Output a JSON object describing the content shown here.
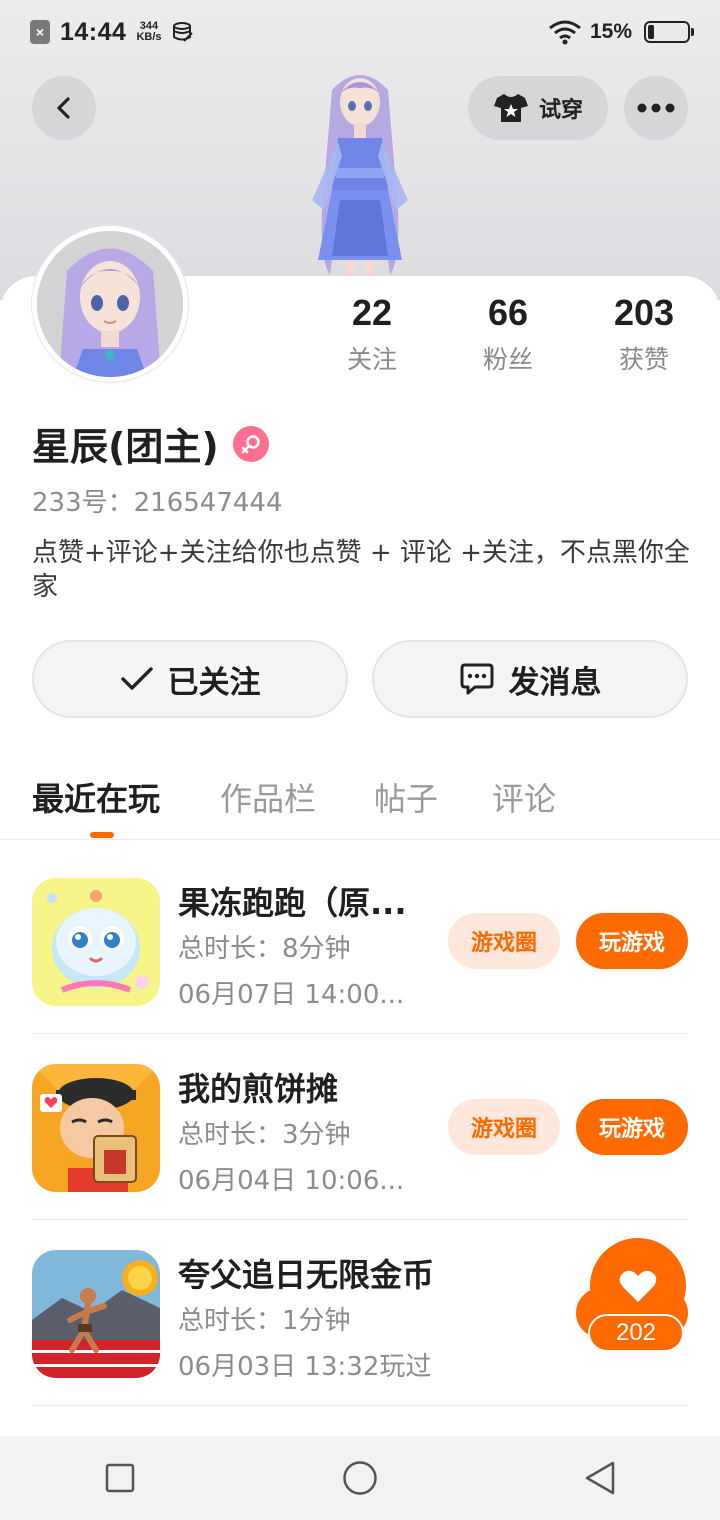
{
  "status_bar": {
    "time": "14:44",
    "speed_value": "344",
    "speed_unit": "KB/s",
    "battery": "15%"
  },
  "header": {
    "try_on_label": "试穿"
  },
  "profile": {
    "stats": [
      {
        "value": "22",
        "label": "关注"
      },
      {
        "value": "66",
        "label": "粉丝"
      },
      {
        "value": "203",
        "label": "获赞"
      }
    ],
    "name": "星辰(团主)",
    "uid": "233号：216547444",
    "bio": "点赞+评论+关注给你也点赞 + 评论  +关注，不点黑你全家",
    "follow_label": "已关注",
    "message_label": "发消息"
  },
  "tabs": [
    "最近在玩",
    "作品栏",
    "帖子",
    "评论"
  ],
  "games": [
    {
      "title": "果冻跑跑（原...",
      "duration": "总时长：8分钟",
      "played": "06月07日 14:00...",
      "circle_label": "游戏圈",
      "play_label": "玩游戏"
    },
    {
      "title": "我的煎饼摊",
      "duration": "总时长：3分钟",
      "played": "06月04日 10:06...",
      "circle_label": "游戏圈",
      "play_label": "玩游戏"
    },
    {
      "title": "夸父追日无限金币",
      "duration": "总时长：1分钟",
      "played": "06月03日 13:32玩过"
    }
  ],
  "like_count": "202",
  "colors": {
    "accent": "#ff6a00",
    "gender": "#ff6f8e"
  }
}
